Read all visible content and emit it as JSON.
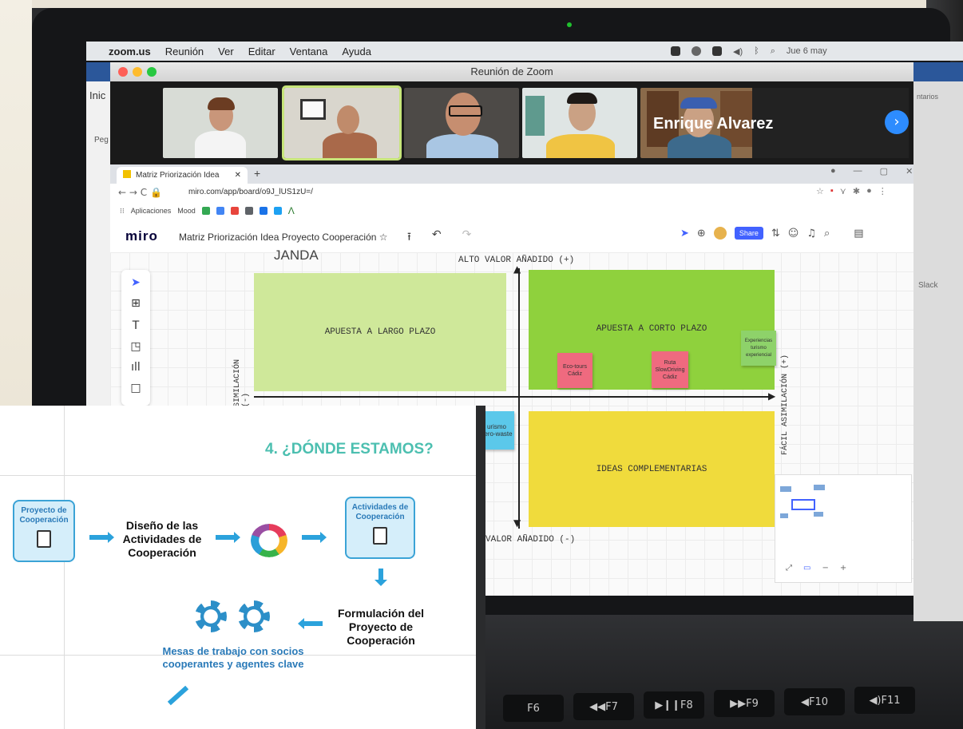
{
  "mac_menubar": {
    "app_name": "zoom.us",
    "menus": [
      "Reunión",
      "Ver",
      "Editar",
      "Ventana",
      "Ayuda"
    ],
    "clock": "Jue 6 may"
  },
  "zoom": {
    "window_title": "Reunión de Zoom",
    "participant_name": "Enrique Alvarez",
    "next_page_icon": "chevron-right-icon"
  },
  "background_apps": {
    "word_tab": "Inic",
    "word_button": "Peg",
    "right_panel_text": "ntarios",
    "slack_label": "Slack"
  },
  "browser": {
    "tab_title": "Matriz Priorización Idea Proyecto",
    "url": "miro.com/app/board/o9J_lUS1zU=/",
    "bookmarks": [
      "Aplicaciones",
      "Mood"
    ]
  },
  "miro": {
    "logo": "miro",
    "board_title": "Matriz Priorización Idea Proyecto Cooperación",
    "share_label": "Share",
    "board_heading": "JANDA",
    "axis_top": "ALTO VALOR AÑADIDO (+)",
    "axis_bottom": "VALOR AÑADIDO (-)",
    "axis_left": "SIMILACIÓN (-)",
    "axis_right": "FÁCIL ASIMILACIÓN (+)",
    "quadrants": {
      "top_left": "APUESTA A LARGO PLAZO",
      "top_right": "APUESTA A CORTO PLAZO",
      "bottom_right": "IDEAS COMPLEMENTARIAS"
    },
    "stickies": {
      "eco": "Eco-tours Cádiz",
      "slow": "Ruta SlowDriving Cádiz",
      "exp": "Experiencias turismo experiencial",
      "zero": "urismo zero-waste"
    },
    "colors": {
      "largo": "#cfe89a",
      "corto": "#8fd13d",
      "ideas": "#f0db3c",
      "sticky_red": "#ef6a7f",
      "sticky_blue": "#5bc8ea",
      "share": "#4262ff"
    }
  },
  "slide": {
    "title": "4. ¿DÓNDE ESTAMOS?",
    "box_proyecto": "Proyecto de Cooperación",
    "step_diseno": "Diseño de las Actividades de Cooperación",
    "box_actividades": "Actividades de Cooperación",
    "step_formulacion": "Formulación del Proyecto de Cooperación",
    "mesas": "Mesas de trabajo con socios cooperantes y agentes clave",
    "accent": "#4cbfb0"
  },
  "keyboard": {
    "keys": [
      "F6",
      "F7",
      "F8",
      "F9",
      "F10",
      "F11"
    ]
  }
}
